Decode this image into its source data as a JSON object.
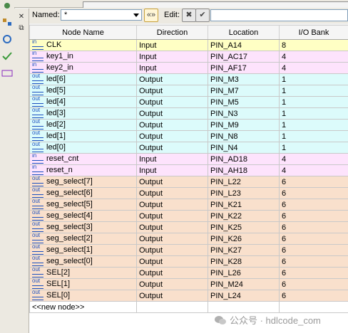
{
  "filter": {
    "named_label": "Named:",
    "named_value": "*",
    "filter_button_label": "«»",
    "edit_label": "Edit:",
    "edit_value": ""
  },
  "columns": [
    "Node Name",
    "Direction",
    "Location",
    "I/O Bank"
  ],
  "rows": [
    {
      "node": "CLK",
      "direction": "Input",
      "location": "PIN_A14",
      "bank": "8",
      "kind": "in",
      "group": "in-clk"
    },
    {
      "node": "key1_in",
      "direction": "Input",
      "location": "PIN_AC17",
      "bank": "4",
      "kind": "in",
      "group": "Input"
    },
    {
      "node": "key2_in",
      "direction": "Input",
      "location": "PIN_AF17",
      "bank": "4",
      "kind": "in",
      "group": "Input"
    },
    {
      "node": "led[6]",
      "direction": "Output",
      "location": "PIN_M3",
      "bank": "1",
      "kind": "out",
      "group": "Output"
    },
    {
      "node": "led[5]",
      "direction": "Output",
      "location": "PIN_M7",
      "bank": "1",
      "kind": "out",
      "group": "Output"
    },
    {
      "node": "led[4]",
      "direction": "Output",
      "location": "PIN_M5",
      "bank": "1",
      "kind": "out",
      "group": "Output"
    },
    {
      "node": "led[3]",
      "direction": "Output",
      "location": "PIN_N3",
      "bank": "1",
      "kind": "out",
      "group": "Output"
    },
    {
      "node": "led[2]",
      "direction": "Output",
      "location": "PIN_M9",
      "bank": "1",
      "kind": "out",
      "group": "Output"
    },
    {
      "node": "led[1]",
      "direction": "Output",
      "location": "PIN_N8",
      "bank": "1",
      "kind": "out",
      "group": "Output"
    },
    {
      "node": "led[0]",
      "direction": "Output",
      "location": "PIN_N4",
      "bank": "1",
      "kind": "out",
      "group": "Output"
    },
    {
      "node": "reset_cnt",
      "direction": "Input",
      "location": "PIN_AD18",
      "bank": "4",
      "kind": "in",
      "group": "Input"
    },
    {
      "node": "reset_n",
      "direction": "Input",
      "location": "PIN_AH18",
      "bank": "4",
      "kind": "in",
      "group": "Input"
    },
    {
      "node": "seg_select[7]",
      "direction": "Output",
      "location": "PIN_L22",
      "bank": "6",
      "kind": "out",
      "group": "seg"
    },
    {
      "node": "seg_select[6]",
      "direction": "Output",
      "location": "PIN_L23",
      "bank": "6",
      "kind": "out",
      "group": "seg"
    },
    {
      "node": "seg_select[5]",
      "direction": "Output",
      "location": "PIN_K21",
      "bank": "6",
      "kind": "out",
      "group": "seg"
    },
    {
      "node": "seg_select[4]",
      "direction": "Output",
      "location": "PIN_K22",
      "bank": "6",
      "kind": "out",
      "group": "seg"
    },
    {
      "node": "seg_select[3]",
      "direction": "Output",
      "location": "PIN_K25",
      "bank": "6",
      "kind": "out",
      "group": "seg"
    },
    {
      "node": "seg_select[2]",
      "direction": "Output",
      "location": "PIN_K26",
      "bank": "6",
      "kind": "out",
      "group": "seg"
    },
    {
      "node": "seg_select[1]",
      "direction": "Output",
      "location": "PIN_K27",
      "bank": "6",
      "kind": "out",
      "group": "seg"
    },
    {
      "node": "seg_select[0]",
      "direction": "Output",
      "location": "PIN_K28",
      "bank": "6",
      "kind": "out",
      "group": "seg"
    },
    {
      "node": "SEL[2]",
      "direction": "Output",
      "location": "PIN_L26",
      "bank": "6",
      "kind": "out",
      "group": "seg"
    },
    {
      "node": "SEL[1]",
      "direction": "Output",
      "location": "PIN_M24",
      "bank": "6",
      "kind": "out",
      "group": "seg"
    },
    {
      "node": "SEL[0]",
      "direction": "Output",
      "location": "PIN_L24",
      "bank": "6",
      "kind": "out",
      "group": "seg"
    }
  ],
  "new_node_label": "<<new node>>",
  "watermark": "公众号 · hdlcode_com",
  "colors": {
    "input_row": "#fde3fc",
    "output_row": "#dcfbfb",
    "clk_row": "#ffffc4",
    "seg_row": "#f9e0cc"
  }
}
